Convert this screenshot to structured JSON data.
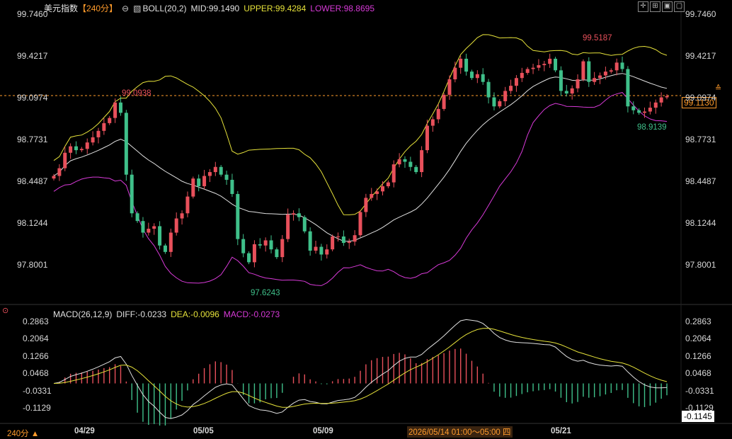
{
  "header": {
    "symbol": "美元指数",
    "interval_tag": "【240分】",
    "indicator": "BOLL(20,2)",
    "mid": "MID:99.1490",
    "upper": "UPPER:99.4284",
    "lower": "LOWER:98.8695"
  },
  "macd_header": {
    "name": "MACD(26,12,9)",
    "diff": "DIFF:-0.0233",
    "dea": "DEA:-0.0096",
    "macd": "MACD:-0.0273"
  },
  "price_axis_left": [
    "99.7460",
    "99.4217",
    "99.0974",
    "98.7731",
    "98.4487",
    "98.1244",
    "97.8001"
  ],
  "price_axis_right": [
    "99.7460",
    "99.4217",
    "99.0974",
    "98.7731",
    "98.4487",
    "98.1244",
    "97.8001"
  ],
  "macd_axis_left": [
    "0.2863",
    "0.2064",
    "0.1266",
    "0.0468",
    "-0.0331",
    "-0.1129"
  ],
  "macd_axis_right": [
    "0.2863",
    "0.2064",
    "0.1266",
    "0.0468",
    "-0.0331",
    "-0.1129"
  ],
  "date_labels": [
    "04/29",
    "05/05",
    "05/09",
    "05/21"
  ],
  "crosshair_time": "2026/05/14 01:00～05:00 四",
  "current_price": "99.1130",
  "current_macd": "-0.1145",
  "annotations": {
    "high1": "99.0938",
    "low1": "97.6243",
    "high2": "99.5187",
    "low2": "98.9139"
  },
  "footer_interval": "240分 ▲",
  "colors": {
    "up": "#e8505b",
    "down": "#3fc08a",
    "upper": "#e6e23a",
    "mid": "#e0e0e0",
    "lower": "#d83ad8",
    "dea": "#e6e23a",
    "accent": "#ff9b2b"
  },
  "chart_data": {
    "type": "candlestick",
    "price_range": [
      97.8001,
      99.746
    ],
    "macd_range": [
      -0.1129,
      0.2863
    ],
    "candle_closes": [
      98.49,
      98.55,
      98.67,
      98.72,
      98.69,
      98.7,
      98.75,
      98.79,
      98.84,
      98.9,
      98.94,
      99.06,
      98.98,
      98.5,
      98.2,
      98.14,
      98.05,
      98.08,
      98.1,
      97.95,
      97.9,
      98.05,
      98.16,
      98.2,
      98.33,
      98.47,
      98.41,
      98.49,
      98.52,
      98.56,
      98.5,
      98.46,
      98.35,
      98.0,
      97.89,
      97.82,
      97.96,
      97.95,
      97.99,
      97.92,
      97.86,
      98.0,
      98.19,
      98.2,
      98.17,
      98.06,
      97.91,
      97.94,
      97.88,
      97.92,
      98.02,
      98.02,
      97.97,
      97.98,
      98.03,
      98.21,
      98.32,
      98.35,
      98.37,
      98.41,
      98.44,
      98.58,
      98.62,
      98.6,
      98.56,
      98.52,
      98.69,
      98.88,
      98.93,
      99.01,
      99.12,
      99.24,
      99.33,
      99.4,
      99.3,
      99.25,
      99.28,
      99.22,
      99.1,
      99.03,
      99.07,
      99.15,
      99.19,
      99.25,
      99.29,
      99.32,
      99.33,
      99.35,
      99.36,
      99.4,
      99.31,
      99.15,
      99.13,
      99.17,
      99.24,
      99.38,
      99.22,
      99.25,
      99.27,
      99.3,
      99.31,
      99.37,
      99.32,
      99.03,
      99.0,
      98.98,
      98.99,
      99.02,
      99.06,
      99.1,
      99.11
    ]
  }
}
